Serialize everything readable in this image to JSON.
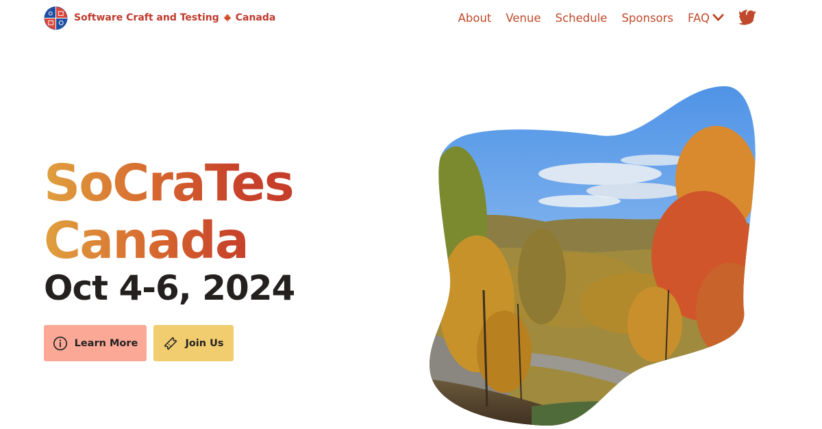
{
  "header": {
    "site_title": "Software Craft and Testing",
    "site_title_suffix": "Canada",
    "logo_icon": "socrates-logo-icon",
    "leaf_icon": "maple-leaf-icon"
  },
  "nav": {
    "items": [
      {
        "label": "About"
      },
      {
        "label": "Venue"
      },
      {
        "label": "Schedule"
      },
      {
        "label": "Sponsors"
      },
      {
        "label": "FAQ"
      }
    ],
    "twitter_icon": "twitter-icon",
    "theme_icon": "moon-icon"
  },
  "hero": {
    "title_line1": "SoCraTes",
    "title_line2": "Canada",
    "date": "Oct 4-6, 2024",
    "buttons": {
      "learn_more": "Learn More",
      "join_us": "Join Us"
    },
    "image": {
      "subject": "Autumn forest valley under blue sky"
    }
  },
  "colors": {
    "accent": "#c0392b",
    "learn_more_bg": "#fca896",
    "join_us_bg": "#f2cd6f",
    "title_gradient_start": "#e0a03e",
    "title_gradient_end": "#c63c2a",
    "date_text": "#23201f"
  }
}
